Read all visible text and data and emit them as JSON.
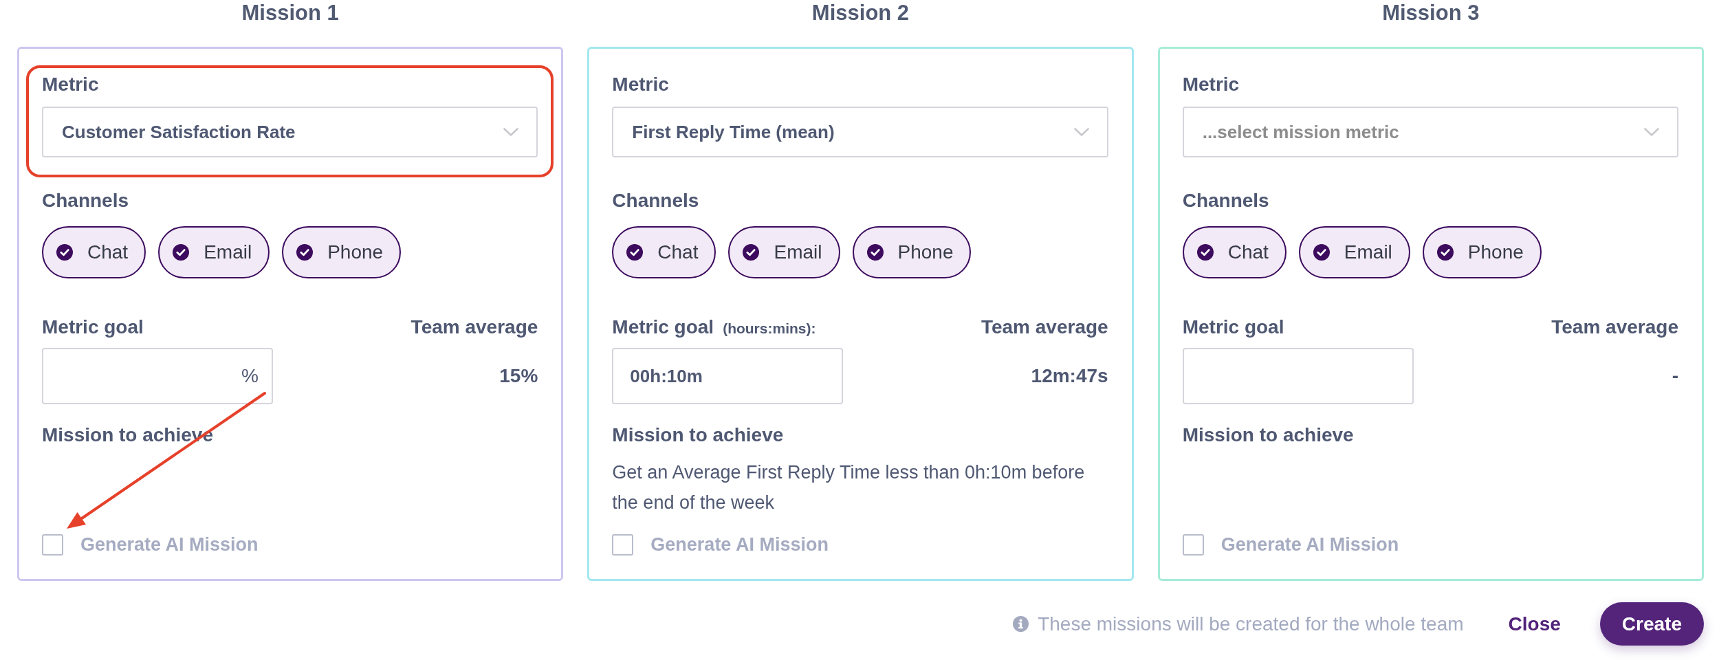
{
  "missions": [
    {
      "title": "Mission 1",
      "color": "#cdc6f0",
      "highlight": true,
      "arrow": true,
      "metric": {
        "label": "Metric",
        "value": "Customer Satisfaction Rate"
      },
      "channels": {
        "label": "Channels",
        "items": [
          {
            "label": "Chat",
            "checked": true
          },
          {
            "label": "Email",
            "checked": true
          },
          {
            "label": "Phone",
            "checked": true
          }
        ]
      },
      "goal": {
        "label": "Metric goal",
        "suffix": "%"
      },
      "team_average": {
        "label": "Team average",
        "value": "15%"
      },
      "mission_to_achieve": {
        "label": "Mission to achieve"
      },
      "ai_mission": {
        "label": "Generate AI Mission",
        "checked": false
      }
    },
    {
      "title": "Mission 2",
      "color": "#a3e7f0",
      "metric": {
        "label": "Metric",
        "value": "First Reply Time (mean)"
      },
      "channels": {
        "label": "Channels",
        "items": [
          {
            "label": "Chat",
            "checked": true
          },
          {
            "label": "Email",
            "checked": true
          },
          {
            "label": "Phone",
            "checked": true
          }
        ]
      },
      "goal": {
        "label": "Metric goal",
        "hint": "(hours:mins):",
        "value": "00h:10m"
      },
      "team_average": {
        "label": "Team average",
        "value": "12m:47s"
      },
      "mission_to_achieve": {
        "label": "Mission to achieve",
        "text": "Get an Average First Reply Time less than 0h:10m before the end of the week"
      },
      "ai_mission": {
        "label": "Generate AI Mission",
        "checked": false
      }
    },
    {
      "title": "Mission 3",
      "color": "#a6ecd8",
      "metric": {
        "label": "Metric",
        "placeholder": "...select mission metric"
      },
      "channels": {
        "label": "Channels",
        "items": [
          {
            "label": "Chat",
            "checked": true
          },
          {
            "label": "Email",
            "checked": true
          },
          {
            "label": "Phone",
            "checked": true
          }
        ]
      },
      "goal": {
        "label": "Metric goal"
      },
      "team_average": {
        "label": "Team average",
        "value": "-"
      },
      "mission_to_achieve": {
        "label": "Mission to achieve"
      },
      "ai_mission": {
        "label": "Generate AI Mission",
        "checked": false
      }
    }
  ],
  "footer": {
    "note": "These missions will be created for the whole team",
    "buttons": [
      {
        "label": "Close",
        "kind": "link"
      },
      {
        "label": "Create",
        "kind": "primary"
      }
    ]
  }
}
